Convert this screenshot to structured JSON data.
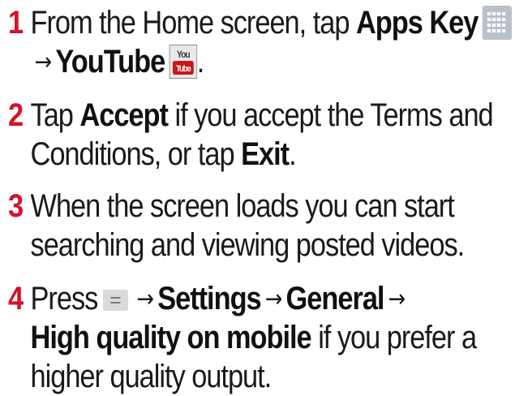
{
  "steps": [
    {
      "number": "1",
      "text_a": "From the Home screen, tap ",
      "bold_a": "Apps Key",
      "arrow": "→",
      "bold_b": "YouTube",
      "end": "."
    },
    {
      "number": "2",
      "text_a": "Tap ",
      "bold_a": "Accept",
      "text_b": " if you accept the Terms and",
      "text_c": "Conditions, or tap ",
      "bold_b": "Exit",
      "end": "."
    },
    {
      "number": "3",
      "text_a": "When the screen loads you can start",
      "text_b": "searching and viewing posted videos."
    },
    {
      "number": "4",
      "text_a": "Press",
      "arrow": "→",
      "bold_a": "Settings",
      "bold_b": "General",
      "bold_c": "High quality on mobile",
      "text_b": " if you prefer a",
      "text_c": "higher quality output."
    }
  ],
  "icons": {
    "apps_key": "apps-grid-icon",
    "youtube": "youtube-app-icon",
    "youtube_top_label": "You",
    "youtube_bottom_label": "Tube",
    "menu_key": "menu-key-icon",
    "accent_color": "#d4122a"
  }
}
